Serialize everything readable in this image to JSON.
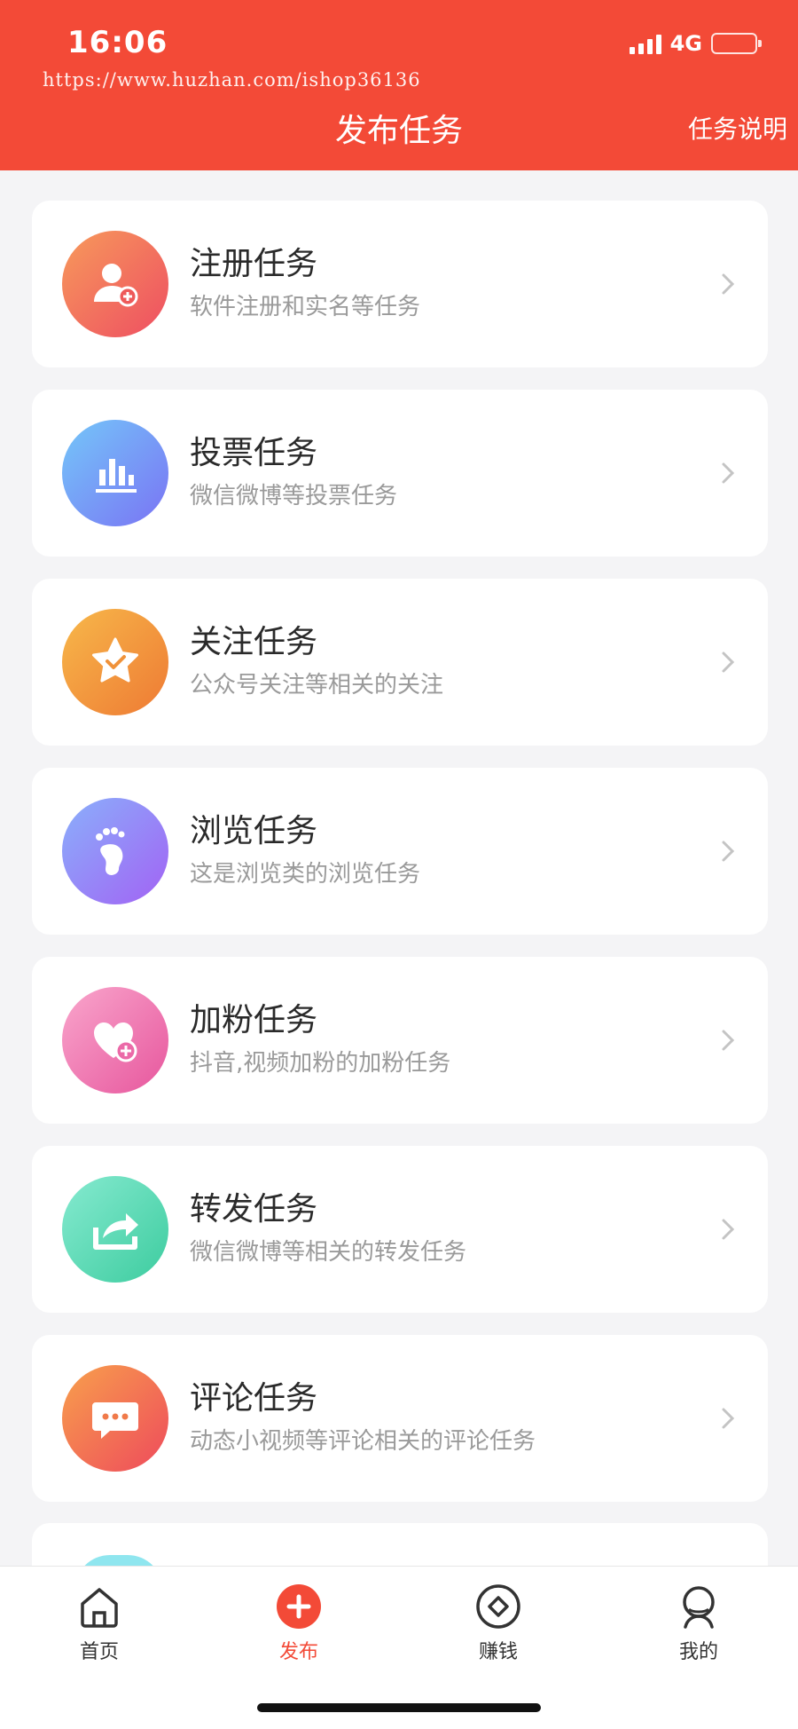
{
  "status_bar": {
    "time": "16:06",
    "network": "4G"
  },
  "watermark": "https://www.huzhan.com/ishop36136",
  "header": {
    "title": "发布任务",
    "help_link": "任务说明"
  },
  "colors": {
    "brand": "#f34a37",
    "background": "#f4f4f6"
  },
  "tasks": [
    {
      "title": "注册任务",
      "desc": "软件注册和实名等任务",
      "icon": "user-add-icon",
      "gradient": [
        "#f79a5b",
        "#ee4e62"
      ]
    },
    {
      "title": "投票任务",
      "desc": "微信微博等投票任务",
      "icon": "bar-chart-icon",
      "gradient": [
        "#74c7f9",
        "#7a73f4"
      ]
    },
    {
      "title": "关注任务",
      "desc": "公众号关注等相关的关注",
      "icon": "star-check-icon",
      "gradient": [
        "#f7b84a",
        "#ee7a34"
      ]
    },
    {
      "title": "浏览任务",
      "desc": "这是浏览类的浏览任务",
      "icon": "footprint-icon",
      "gradient": [
        "#8ab0fb",
        "#a262f4"
      ]
    },
    {
      "title": "加粉任务",
      "desc": "抖音,视频加粉的加粉任务",
      "icon": "heart-add-icon",
      "gradient": [
        "#f9a6cc",
        "#e7569d"
      ]
    },
    {
      "title": "转发任务",
      "desc": "微信微博等相关的转发任务",
      "icon": "share-icon",
      "gradient": [
        "#86ead0",
        "#3dcc9f"
      ]
    },
    {
      "title": "评论任务",
      "desc": "动态小视频等评论相关的评论任务",
      "icon": "comment-icon",
      "gradient": [
        "#f8a04c",
        "#ee4a5c"
      ]
    }
  ],
  "tabbar": {
    "items": [
      {
        "label": "首页",
        "icon": "home-icon"
      },
      {
        "label": "发布",
        "icon": "plus-circle-icon",
        "active": true
      },
      {
        "label": "赚钱",
        "icon": "coin-icon"
      },
      {
        "label": "我的",
        "icon": "profile-icon"
      }
    ]
  }
}
